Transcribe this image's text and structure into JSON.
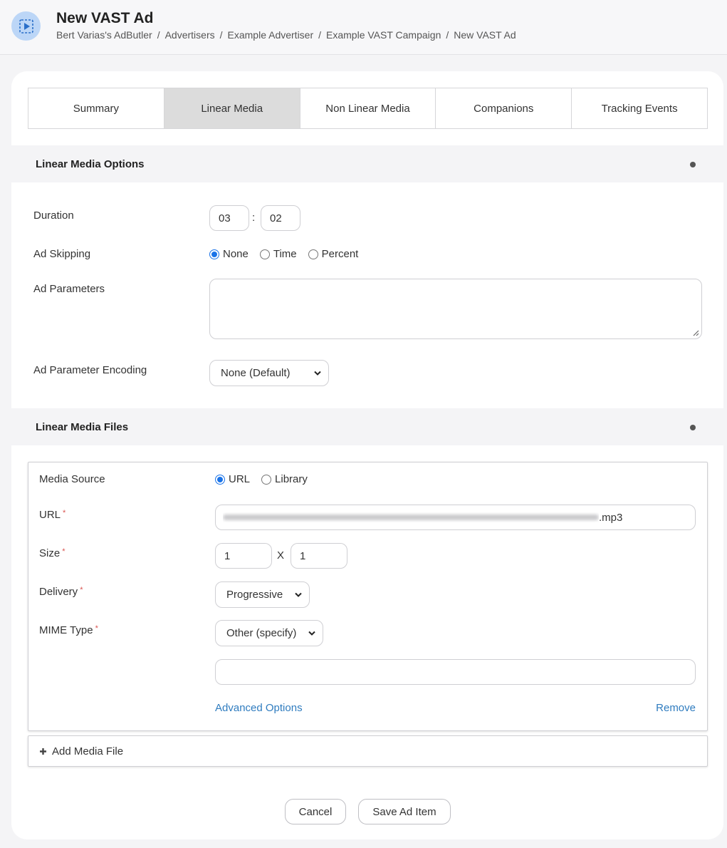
{
  "header": {
    "title": "New VAST Ad",
    "breadcrumb": [
      "Bert Varias's AdButler",
      "Advertisers",
      "Example Advertiser",
      "Example VAST Campaign",
      "New VAST Ad"
    ],
    "icon": "video-play-icon"
  },
  "tabs": [
    "Summary",
    "Linear Media",
    "Non Linear Media",
    "Companions",
    "Tracking Events"
  ],
  "active_tab": "Linear Media",
  "options_section": {
    "title": "Linear Media Options",
    "duration_label": "Duration",
    "duration_minutes": "03",
    "duration_separator": ":",
    "duration_seconds": "02",
    "skipping_label": "Ad Skipping",
    "skipping_options": [
      "None",
      "Time",
      "Percent"
    ],
    "skipping_selected": "None",
    "parameters_label": "Ad Parameters",
    "parameters_value": "",
    "encoding_label": "Ad Parameter Encoding",
    "encoding_value": "None (Default)"
  },
  "files_section": {
    "title": "Linear Media Files",
    "media_source_label": "Media Source",
    "media_source_options": [
      "URL",
      "Library"
    ],
    "media_source_selected": "URL",
    "url_label": "URL",
    "url_value_visible_suffix": ".mp3",
    "size_label": "Size",
    "size_width": "1",
    "size_separator": "X",
    "size_height": "1",
    "delivery_label": "Delivery",
    "delivery_value": "Progressive",
    "mime_label": "MIME Type",
    "mime_value": "Other (specify)",
    "mime_custom_value": "",
    "advanced_link": "Advanced Options",
    "remove_link": "Remove",
    "add_media_label": "Add Media File"
  },
  "actions": {
    "cancel": "Cancel",
    "save": "Save Ad Item"
  },
  "colors": {
    "accent": "#1a73e8",
    "link": "#2f7cbf",
    "active_tab_bg": "#dcdcdc",
    "required": "#d9534f"
  }
}
